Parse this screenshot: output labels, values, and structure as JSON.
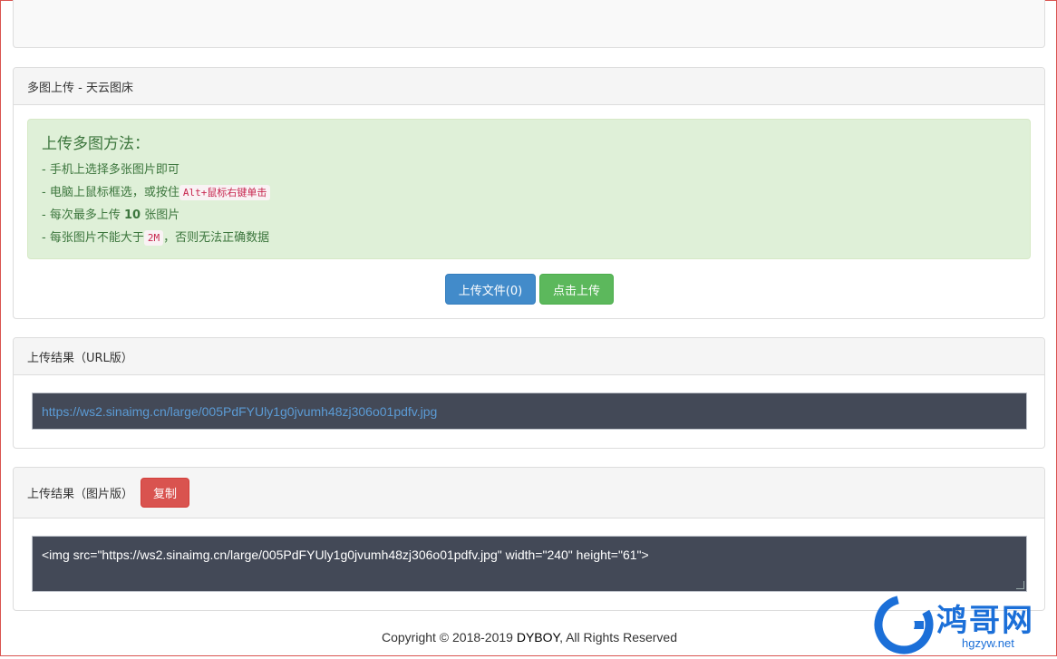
{
  "upload_panel": {
    "title": "多图上传 - 天云图床",
    "instructions": {
      "heading": "上传多图方法：",
      "line1": "- 手机上选择多张图片即可",
      "line2_prefix": "- 电脑上鼠标框选，或按住",
      "line2_code": "Alt+鼠标右键单击",
      "line3_prefix": "- 每次最多上传 ",
      "line3_bold": "10",
      "line3_suffix": " 张图片",
      "line4_prefix": "- 每张图片不能大于",
      "line4_code": "2M",
      "line4_suffix": "，否则无法正确数据"
    },
    "choose_label": "上传文件(0)",
    "upload_label": "点击上传"
  },
  "url_panel": {
    "title": "上传结果（URL版）",
    "url": "https://ws2.sinaimg.cn/large/005PdFYUly1g0jvumh48zj306o01pdfv.jpg"
  },
  "img_panel": {
    "title": "上传结果（图片版）",
    "copy_label": "复制",
    "html_code": "<img src=\"https://ws2.sinaimg.cn/large/005PdFYUly1g0jvumh48zj306o01pdfv.jpg\" width=\"240\" height=\"61\">"
  },
  "footer": {
    "prefix": "Copyright © 2018-2019 ",
    "brand": "DYBOY",
    "suffix": ", All Rights Reserved"
  },
  "watermark": {
    "text": "鸿哥网",
    "url": "hgzyw.net"
  },
  "colors": {
    "primary": "#428bca",
    "success": "#5cb85c",
    "danger": "#d9534f",
    "alert_bg": "#dff0d8",
    "code_bg": "#434957"
  }
}
